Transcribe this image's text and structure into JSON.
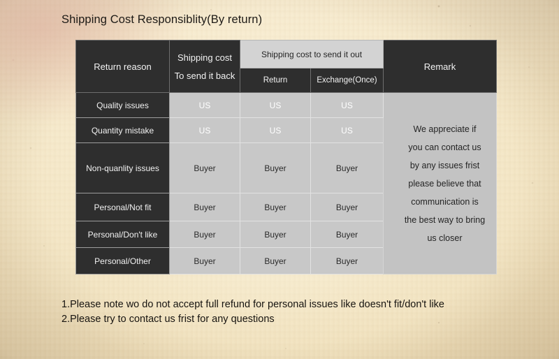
{
  "title": "Shipping Cost Responsiblity(By return)",
  "table": {
    "headers": {
      "return_reason": "Return reason",
      "shipping_cost_back_line1": "Shipping cost",
      "shipping_cost_back_line2": "To send it back",
      "shipping_cost_out": "Shipping cost to send it out",
      "sub_return": "Return",
      "sub_exchange": "Exchange(Once)",
      "remark": "Remark"
    },
    "rows": [
      {
        "reason": "Quality issues",
        "send_back": "US",
        "return": "US",
        "exchange": "US"
      },
      {
        "reason": "Quantity mistake",
        "send_back": "US",
        "return": "US",
        "exchange": "US"
      },
      {
        "reason": "Non-quanlity issues",
        "send_back": "Buyer",
        "return": "Buyer",
        "exchange": "Buyer"
      },
      {
        "reason": "Personal/Not fit",
        "send_back": "Buyer",
        "return": "Buyer",
        "exchange": "Buyer"
      },
      {
        "reason": "Personal/Don't like",
        "send_back": "Buyer",
        "return": "Buyer",
        "exchange": "Buyer"
      },
      {
        "reason": "Personal/Other",
        "send_back": "Buyer",
        "return": "Buyer",
        "exchange": "Buyer"
      }
    ],
    "remark_lines": [
      "We appreciate if",
      "you can contact us",
      "by any issues frist",
      "please believe that",
      "communication is",
      "the best way to bring",
      "us closer"
    ]
  },
  "notes": [
    "1.Please note wo do not accept full refund for personal issues like doesn't fit/don't like",
    "2.Please try to contact us frist for any questions"
  ],
  "colors": {
    "paper": "#f3e6c9",
    "header_dark": "#2e2e2e",
    "header_span": "#d3d3d3",
    "cell_gray": "#c8c8c8",
    "remark_gray": "#c3c3c3",
    "text_dark": "#1d1a16",
    "text_light": "#f2f2f2"
  }
}
